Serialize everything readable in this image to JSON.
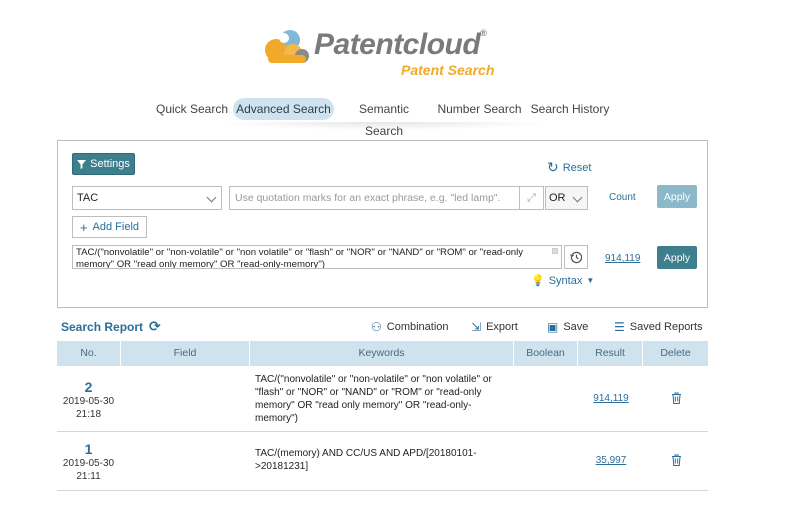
{
  "brand": {
    "name": "Patentcloud",
    "registered": "®",
    "product": "Patent Search",
    "colors": {
      "orange": "#f0a928",
      "blue": "#7fb8d8",
      "gray": "#7a7a7a"
    }
  },
  "nav": {
    "tabs": [
      {
        "label": "Quick Search",
        "active": false
      },
      {
        "label": "Advanced Search",
        "active": true
      },
      {
        "label": "Semantic Search",
        "active": false
      },
      {
        "label": "Number Search",
        "active": false
      },
      {
        "label": "Search History",
        "active": false
      }
    ]
  },
  "search": {
    "settings_label": "Settings",
    "reset_label": "Reset",
    "field_value": "TAC",
    "query_placeholder": "Use quotation marks for an exact phrase, e.g. \"led lamp\".",
    "operator_value": "OR",
    "count_label": "Count",
    "apply_label_disabled": "Apply",
    "add_field_label": "Add Field",
    "query_text": "TAC/(\"nonvolatile\" or \"non-volatile\" or \"non volatile\" or \"flash\" or \"NOR\" or \"NAND\" or \"ROM\" or \"read-only memory\" OR \"read only memory\" OR \"read-only-memory\")",
    "result_count": "914,119",
    "apply_label": "Apply",
    "syntax_label": "Syntax"
  },
  "report": {
    "title": "Search Report",
    "tools": {
      "combination": "Combination",
      "export": "Export",
      "save": "Save",
      "saved_reports": "Saved Reports"
    },
    "columns": [
      "No.",
      "Field",
      "Keywords",
      "Boolean",
      "Result",
      "Delete"
    ],
    "rows": [
      {
        "no": "2",
        "date": "2019-05-30",
        "time": "21:18",
        "field": "",
        "keywords": "TAC/(\"nonvolatile\" or \"non-volatile\" or \"non volatile\" or \"flash\" or \"NOR\" or \"NAND\" or \"ROM\" or \"read-only memory\" OR \"read only memory\" OR \"read-only-memory\")",
        "boolean": "",
        "result": "914,119"
      },
      {
        "no": "1",
        "date": "2019-05-30",
        "time": "21:11",
        "field": "",
        "keywords": "TAC/(memory) AND CC/US AND APD/[20180101->20181231]",
        "boolean": "",
        "result": "35,997"
      }
    ]
  }
}
